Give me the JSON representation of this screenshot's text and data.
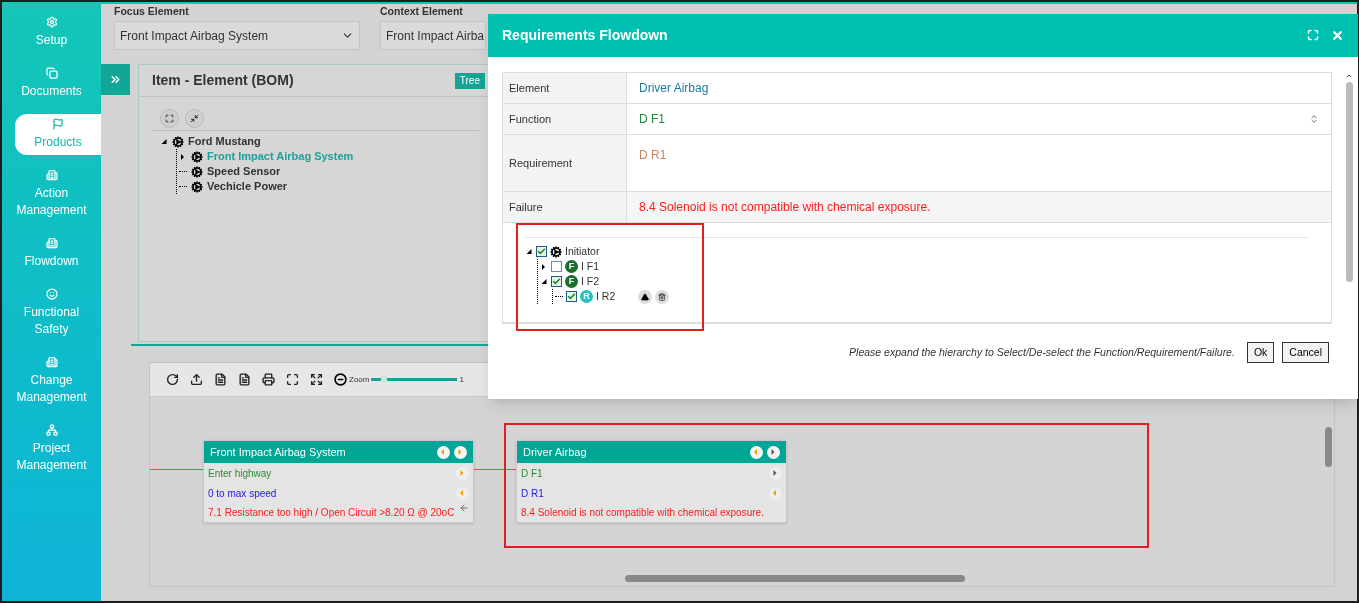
{
  "sidebar": {
    "items": [
      {
        "label": "Setup",
        "selected": false
      },
      {
        "label": "Documents",
        "selected": false
      },
      {
        "label": "Products",
        "selected": true
      },
      {
        "label": "Action Management",
        "selected": false
      },
      {
        "label": "Flowdown",
        "selected": false
      },
      {
        "label": "Functional Safety",
        "selected": false
      },
      {
        "label": "Change Management",
        "selected": false
      },
      {
        "label": "Project Management",
        "selected": false
      }
    ]
  },
  "filters": [
    {
      "label": "Focus Element",
      "value": "Front Impact Airbag System"
    },
    {
      "label": "Context Element",
      "value": "Front Impact Airba"
    }
  ],
  "bom_panel": {
    "title": "Item - Element (BOM)",
    "view_toggle": "Tree",
    "tree": [
      {
        "label": "Ford Mustang",
        "selected": false,
        "expanded": true,
        "children": [
          {
            "label": "Front Impact Airbag System",
            "selected": true,
            "expanded": false
          },
          {
            "label": "Speed Sensor",
            "selected": false
          },
          {
            "label": "Vechicle Power",
            "selected": false
          }
        ]
      }
    ]
  },
  "diagram": {
    "toolbar": {
      "zoom_label": "Zoom",
      "zoom_value": "1",
      "level": 0.12
    },
    "nodes": [
      {
        "title": "Front Impact Airbag System",
        "function": "Enter highway",
        "requirement": "0 to max speed",
        "failure": "7.1 Resistance too high / Open Circuit >8.20 Ω @ 20oC"
      },
      {
        "title": "Driver Airbag",
        "function": "D F1",
        "requirement": "D R1",
        "failure": "8.4 Solenoid is not compatible with chemical exposure."
      }
    ]
  },
  "modal": {
    "title": "Requirements Flowdown",
    "fields": [
      {
        "label": "Element",
        "value": "Driver Airbag",
        "kind": "element"
      },
      {
        "label": "Function",
        "value": "D F1",
        "kind": "function"
      },
      {
        "label": "Requirement",
        "value": "D R1",
        "kind": "requirement"
      },
      {
        "label": "Failure",
        "value": "8.4 Solenoid is not compatible with chemical exposure.",
        "kind": "failure"
      }
    ],
    "tree": [
      {
        "label": "Initiator",
        "checked": true,
        "expanded": true,
        "children": [
          {
            "label": "I F1",
            "badge": "F",
            "checked": false,
            "expanded": false
          },
          {
            "label": "I F2",
            "badge": "F",
            "checked": true,
            "expanded": true,
            "children": [
              {
                "label": "I R2",
                "badge": "R",
                "checked": true
              }
            ]
          }
        ]
      }
    ],
    "hint": "Please expand the hierarchy to Select/De-select the Function/Requirement/Failure.",
    "buttons": [
      "Ok",
      "Cancel"
    ]
  }
}
